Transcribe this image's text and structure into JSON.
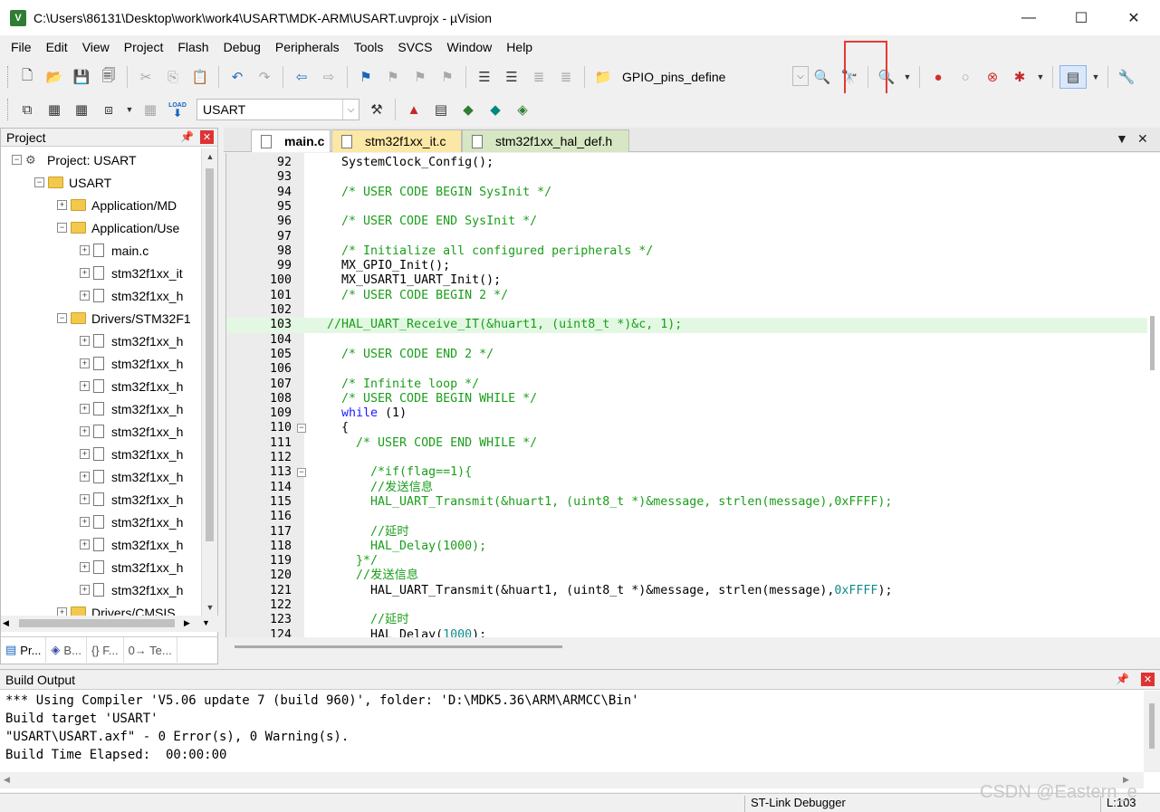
{
  "window": {
    "title": "C:\\Users\\86131\\Desktop\\work\\work4\\USART\\MDK-ARM\\USART.uvprojx - µVision",
    "app_icon": "V",
    "minimize": "—",
    "maximize": "☐",
    "close": "✕"
  },
  "menu": [
    "File",
    "Edit",
    "View",
    "Project",
    "Flash",
    "Debug",
    "Peripherals",
    "Tools",
    "SVCS",
    "Window",
    "Help"
  ],
  "toolbar": {
    "find_combo": "GPIO_pins_define",
    "target_combo": "USART",
    "icons": {
      "new": "new-file-icon",
      "open": "open-icon",
      "save": "save-icon",
      "save_all": "save-all-icon",
      "cut": "cut-icon",
      "copy": "copy-icon",
      "paste": "paste-icon",
      "undo": "undo-icon",
      "redo": "redo-icon",
      "back": "nav-back-icon",
      "forward": "nav-forward-icon",
      "debug": "start-debug-icon",
      "breakpoint": "breakpoint-icon"
    },
    "load_label": "LOAD"
  },
  "project_pane": {
    "title": "Project",
    "pin": "📌",
    "close": "✕",
    "tree": [
      {
        "label": "Project: USART",
        "level": 0,
        "kind": "project",
        "expander": "−"
      },
      {
        "label": "USART",
        "level": 1,
        "kind": "folder",
        "expander": "−"
      },
      {
        "label": "Application/MD",
        "level": 2,
        "kind": "folder",
        "expander": "+"
      },
      {
        "label": "Application/Use",
        "level": 2,
        "kind": "folder",
        "expander": "−"
      },
      {
        "label": "main.c",
        "level": 3,
        "kind": "file",
        "expander": "+"
      },
      {
        "label": "stm32f1xx_it",
        "level": 3,
        "kind": "file",
        "expander": "+"
      },
      {
        "label": "stm32f1xx_h",
        "level": 3,
        "kind": "file",
        "expander": "+"
      },
      {
        "label": "Drivers/STM32F1",
        "level": 2,
        "kind": "folder",
        "expander": "−"
      },
      {
        "label": "stm32f1xx_h",
        "level": 3,
        "kind": "file",
        "expander": "+"
      },
      {
        "label": "stm32f1xx_h",
        "level": 3,
        "kind": "file",
        "expander": "+"
      },
      {
        "label": "stm32f1xx_h",
        "level": 3,
        "kind": "file",
        "expander": "+"
      },
      {
        "label": "stm32f1xx_h",
        "level": 3,
        "kind": "file",
        "expander": "+"
      },
      {
        "label": "stm32f1xx_h",
        "level": 3,
        "kind": "file",
        "expander": "+"
      },
      {
        "label": "stm32f1xx_h",
        "level": 3,
        "kind": "file",
        "expander": "+"
      },
      {
        "label": "stm32f1xx_h",
        "level": 3,
        "kind": "file",
        "expander": "+"
      },
      {
        "label": "stm32f1xx_h",
        "level": 3,
        "kind": "file",
        "expander": "+"
      },
      {
        "label": "stm32f1xx_h",
        "level": 3,
        "kind": "file",
        "expander": "+"
      },
      {
        "label": "stm32f1xx_h",
        "level": 3,
        "kind": "file",
        "expander": "+"
      },
      {
        "label": "stm32f1xx_h",
        "level": 3,
        "kind": "file",
        "expander": "+"
      },
      {
        "label": "stm32f1xx_h",
        "level": 3,
        "kind": "file",
        "expander": "+"
      },
      {
        "label": "Drivers/CMSIS",
        "level": 2,
        "kind": "folder",
        "expander": "+"
      }
    ],
    "tabs": [
      {
        "label": "Pr...",
        "icon": "project-tab-icon"
      },
      {
        "label": "B...",
        "icon": "books-tab-icon"
      },
      {
        "label": "{} F...",
        "icon": "functions-tab-icon"
      },
      {
        "label": "0→ Te...",
        "icon": "templates-tab-icon"
      }
    ]
  },
  "editor": {
    "tabs": [
      {
        "label": "main.c",
        "style": "active"
      },
      {
        "label": "stm32f1xx_it.c",
        "style": "yellow"
      },
      {
        "label": "stm32f1xx_hal_def.h",
        "style": "green"
      }
    ],
    "dropdown": "▼",
    "close": "✕",
    "current_line": 103,
    "lines": [
      {
        "n": "92",
        "fold": "",
        "parts": [
          [
            "",
            "  SystemClock_Config();"
          ]
        ]
      },
      {
        "n": "93",
        "fold": "",
        "parts": [
          [
            "",
            ""
          ]
        ]
      },
      {
        "n": "94",
        "fold": "",
        "parts": [
          [
            "cm",
            "  /* USER CODE BEGIN SysInit */"
          ]
        ]
      },
      {
        "n": "95",
        "fold": "",
        "parts": [
          [
            "",
            ""
          ]
        ]
      },
      {
        "n": "96",
        "fold": "",
        "parts": [
          [
            "cm",
            "  /* USER CODE END SysInit */"
          ]
        ]
      },
      {
        "n": "97",
        "fold": "",
        "parts": [
          [
            "",
            ""
          ]
        ]
      },
      {
        "n": "98",
        "fold": "",
        "parts": [
          [
            "cm",
            "  /* Initialize all configured peripherals */"
          ]
        ]
      },
      {
        "n": "99",
        "fold": "",
        "parts": [
          [
            "",
            "  MX_GPIO_Init();"
          ]
        ]
      },
      {
        "n": "100",
        "fold": "",
        "parts": [
          [
            "",
            "  MX_USART1_UART_Init();"
          ]
        ]
      },
      {
        "n": "101",
        "fold": "",
        "parts": [
          [
            "cm",
            "  /* USER CODE BEGIN 2 */"
          ]
        ]
      },
      {
        "n": "102",
        "fold": "",
        "parts": [
          [
            "",
            ""
          ]
        ]
      },
      {
        "n": "103",
        "fold": "",
        "parts": [
          [
            "cm",
            "//HAL_UART_Receive_IT(&huart1, (uint8_t *)&c, 1);"
          ]
        ]
      },
      {
        "n": "104",
        "fold": "",
        "parts": [
          [
            "",
            ""
          ]
        ]
      },
      {
        "n": "105",
        "fold": "",
        "parts": [
          [
            "cm",
            "  /* USER CODE END 2 */"
          ]
        ]
      },
      {
        "n": "106",
        "fold": "",
        "parts": [
          [
            "",
            ""
          ]
        ]
      },
      {
        "n": "107",
        "fold": "",
        "parts": [
          [
            "cm",
            "  /* Infinite loop */"
          ]
        ]
      },
      {
        "n": "108",
        "fold": "",
        "parts": [
          [
            "cm",
            "  /* USER CODE BEGIN WHILE */"
          ]
        ]
      },
      {
        "n": "109",
        "fold": "",
        "parts": [
          [
            "kw",
            "  while"
          ],
          [
            "",
            " (1)"
          ]
        ]
      },
      {
        "n": "110",
        "fold": "−",
        "parts": [
          [
            "",
            "  {"
          ]
        ]
      },
      {
        "n": "111",
        "fold": "",
        "parts": [
          [
            "cm",
            "    /* USER CODE END WHILE */"
          ]
        ]
      },
      {
        "n": "112",
        "fold": "",
        "parts": [
          [
            "",
            ""
          ]
        ]
      },
      {
        "n": "113",
        "fold": "−",
        "parts": [
          [
            "cm",
            "      /*if(flag==1){"
          ]
        ]
      },
      {
        "n": "114",
        "fold": "",
        "parts": [
          [
            "cm",
            "      //发送信息"
          ]
        ]
      },
      {
        "n": "115",
        "fold": "",
        "parts": [
          [
            "cm",
            "      HAL_UART_Transmit(&huart1, (uint8_t *)&message, strlen(message),0xFFFF);"
          ]
        ]
      },
      {
        "n": "116",
        "fold": "",
        "parts": [
          [
            "",
            ""
          ]
        ]
      },
      {
        "n": "117",
        "fold": "",
        "parts": [
          [
            "cm",
            "      //延时"
          ]
        ]
      },
      {
        "n": "118",
        "fold": "",
        "parts": [
          [
            "cm",
            "      HAL_Delay(1000);"
          ]
        ]
      },
      {
        "n": "119",
        "fold": "",
        "parts": [
          [
            "cm",
            "    }*/"
          ]
        ]
      },
      {
        "n": "120",
        "fold": "",
        "parts": [
          [
            "cm",
            "    //发送信息"
          ]
        ]
      },
      {
        "n": "121",
        "fold": "",
        "parts": [
          [
            "",
            "      HAL_UART_Transmit(&huart1, (uint8_t *)&message, strlen(message),"
          ],
          [
            "num",
            "0xFFFF"
          ],
          [
            "",
            ");"
          ]
        ]
      },
      {
        "n": "122",
        "fold": "",
        "parts": [
          [
            "",
            ""
          ]
        ]
      },
      {
        "n": "123",
        "fold": "",
        "parts": [
          [
            "cm",
            "      //延时"
          ]
        ]
      },
      {
        "n": "124",
        "fold": "",
        "parts": [
          [
            "",
            "      HAL_Delay("
          ],
          [
            "num",
            "1000"
          ],
          [
            "",
            ");"
          ]
        ]
      }
    ]
  },
  "build_output": {
    "title": "Build Output",
    "pin": "📌",
    "close": "✕",
    "lines": [
      "*** Using Compiler 'V5.06 update 7 (build 960)', folder: 'D:\\MDK5.36\\ARM\\ARMCC\\Bin'",
      "Build target 'USART'",
      "\"USART\\USART.axf\" - 0 Error(s), 0 Warning(s).",
      "Build Time Elapsed:  00:00:00"
    ]
  },
  "status": {
    "debugger": "ST-Link Debugger",
    "position": "L:103"
  },
  "watermark": "CSDN @Eastern_e"
}
